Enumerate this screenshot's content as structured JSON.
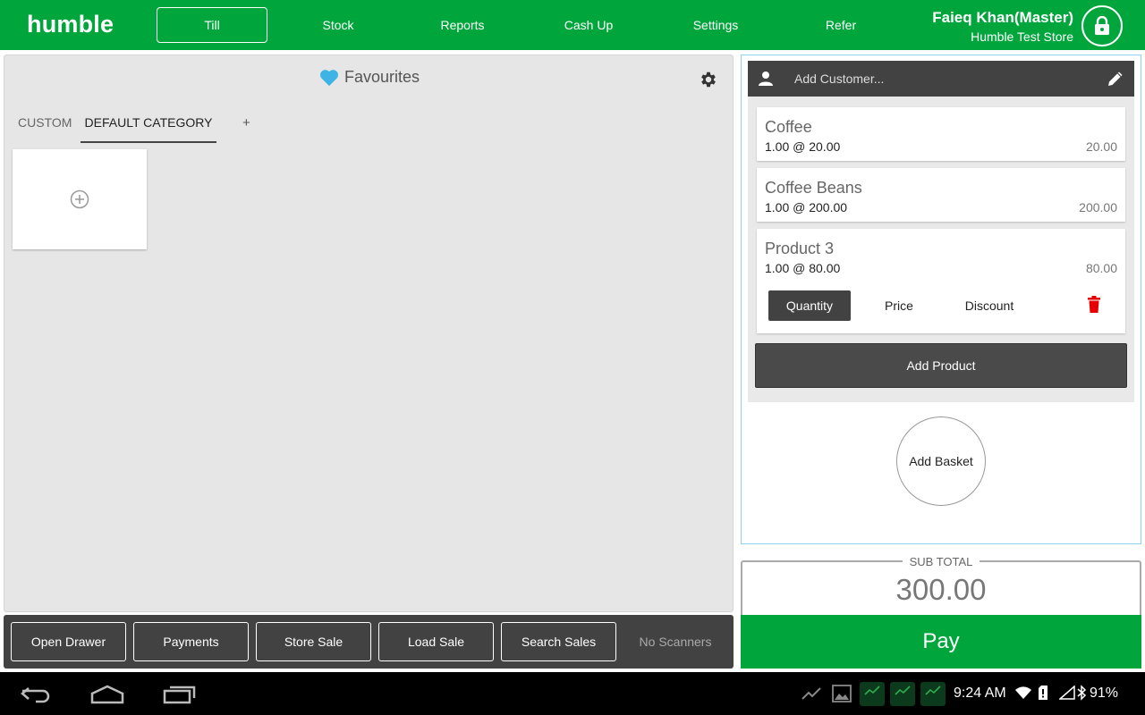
{
  "header": {
    "brand": "humble",
    "nav": [
      {
        "label": "Till",
        "active": true
      },
      {
        "label": "Stock"
      },
      {
        "label": "Reports"
      },
      {
        "label": "Cash Up"
      },
      {
        "label": "Settings"
      },
      {
        "label": "Refer"
      }
    ],
    "user_name": "Faieq Khan(Master)",
    "store_name": "Humble Test Store",
    "lock_icon": "lock-icon"
  },
  "favourites": {
    "title": "Favourites",
    "tabs": [
      {
        "label": "CUSTOM"
      },
      {
        "label": "DEFAULT CATEGORY",
        "active": true
      },
      {
        "label": "+"
      }
    ]
  },
  "actions": {
    "open_drawer": "Open Drawer",
    "payments": "Payments",
    "store_sale": "Store Sale",
    "load_sale": "Load Sale",
    "search_sales": "Search Sales",
    "scanner_status": "No Scanners"
  },
  "basket": {
    "customer_placeholder": "Add Customer...",
    "items": [
      {
        "name": "Coffee",
        "qty_line": "1.00 @ 20.00",
        "total": "20.00"
      },
      {
        "name": "Coffee Beans",
        "qty_line": "1.00 @ 200.00",
        "total": "200.00"
      },
      {
        "name": "Product 3",
        "qty_line": "1.00 @ 80.00",
        "total": "80.00"
      }
    ],
    "item_actions": {
      "quantity": "Quantity",
      "price": "Price",
      "discount": "Discount"
    },
    "add_product": "Add Product",
    "add_basket": "Add Basket"
  },
  "totals": {
    "subtotal_label": "SUB TOTAL",
    "subtotal_value": "300.00",
    "pay_label": "Pay"
  },
  "system_bar": {
    "time": "9:24 AM",
    "battery": "91%"
  },
  "colors": {
    "brand_green": "#00a63c",
    "dark_gray": "#424242",
    "heart_blue": "#3db4e5",
    "delete_red": "#e60000"
  }
}
